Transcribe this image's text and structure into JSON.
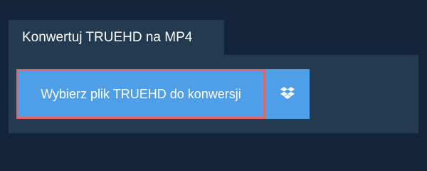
{
  "tab": {
    "title": "Konwertuj TRUEHD na MP4"
  },
  "actions": {
    "select_file_label": "Wybierz plik TRUEHD do konwersji",
    "dropbox_icon": "dropbox-icon"
  },
  "colors": {
    "background": "#14253b",
    "panel": "#233a51",
    "button": "#4f9fe8",
    "highlight_border": "#e06666",
    "text": "#ffffff"
  }
}
